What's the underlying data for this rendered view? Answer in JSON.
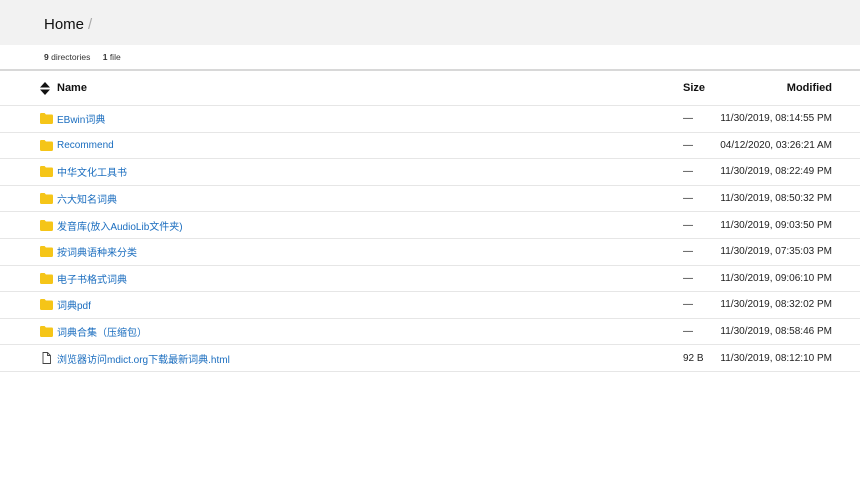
{
  "breadcrumb": {
    "home": "Home",
    "separator": "/"
  },
  "summary": {
    "dir_count": "9",
    "dir_label": "directories",
    "file_count": "1",
    "file_label": "file"
  },
  "columns": {
    "name": "Name",
    "size": "Size",
    "modified": "Modified"
  },
  "colors": {
    "folder": "#f5c518",
    "link": "#1a6dbf",
    "header_bg": "#f2f2f2"
  },
  "rows": [
    {
      "icon": "folder-icon",
      "name": "EBwin词典",
      "size": "—",
      "modified": "11/30/2019, 08:14:55 PM"
    },
    {
      "icon": "folder-icon",
      "name": "Recommend",
      "size": "—",
      "modified": "04/12/2020, 03:26:21 AM"
    },
    {
      "icon": "folder-icon",
      "name": "中华文化工具书",
      "size": "—",
      "modified": "11/30/2019, 08:22:49 PM"
    },
    {
      "icon": "folder-icon",
      "name": "六大知名词典",
      "size": "—",
      "modified": "11/30/2019, 08:50:32 PM"
    },
    {
      "icon": "folder-icon",
      "name": "发音库(放入AudioLib文件夹)",
      "size": "—",
      "modified": "11/30/2019, 09:03:50 PM"
    },
    {
      "icon": "folder-icon",
      "name": "按词典语种来分类",
      "size": "—",
      "modified": "11/30/2019, 07:35:03 PM"
    },
    {
      "icon": "folder-icon",
      "name": "电子书格式词典",
      "size": "—",
      "modified": "11/30/2019, 09:06:10 PM"
    },
    {
      "icon": "folder-icon",
      "name": "词典pdf",
      "size": "—",
      "modified": "11/30/2019, 08:32:02 PM"
    },
    {
      "icon": "folder-icon",
      "name": "词典合集（压缩包）",
      "size": "—",
      "modified": "11/30/2019, 08:58:46 PM"
    },
    {
      "icon": "file-icon",
      "name": "浏览器访问mdict.org下载最新词典.html",
      "size": "92 B",
      "modified": "11/30/2019, 08:12:10 PM"
    }
  ]
}
